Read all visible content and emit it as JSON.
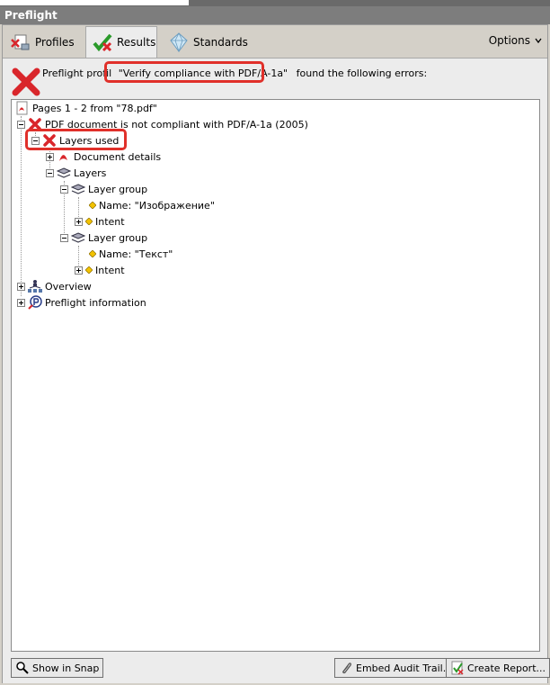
{
  "window": {
    "title": "Preflight"
  },
  "tabs": [
    {
      "label": "Profiles",
      "icon": "profiles-icon"
    },
    {
      "label": "Results",
      "icon": "check-icon"
    },
    {
      "label": "Standards",
      "icon": "diamond-icon"
    }
  ],
  "options_label": "Options",
  "message": {
    "prefix": "Preflight profil",
    "profile": "\"Verify compliance with PDF/A-1a\"",
    "suffix": "found the following errors:"
  },
  "tree": {
    "pages": "Pages 1 - 2 from \"78.pdf\"",
    "not_compliant": "PDF document is not compliant with PDF/A-1a (2005)",
    "layers_used": "Layers used",
    "document_details": "Document details",
    "layers": "Layers",
    "group1": {
      "label": "Layer group",
      "name": "Name: \"Изображение\"",
      "intent": "Intent"
    },
    "group2": {
      "label": "Layer group",
      "name": "Name: \"Текст\"",
      "intent": "Intent"
    },
    "overview": "Overview",
    "preflight_information": "Preflight information"
  },
  "buttons": {
    "show_in_snap": "Show in Snap",
    "embed_audit_trail": "Embed Audit Trail...",
    "create_report": "Create Report..."
  },
  "colors": {
    "error": "#d9262b",
    "highlight": "#e0302a"
  }
}
